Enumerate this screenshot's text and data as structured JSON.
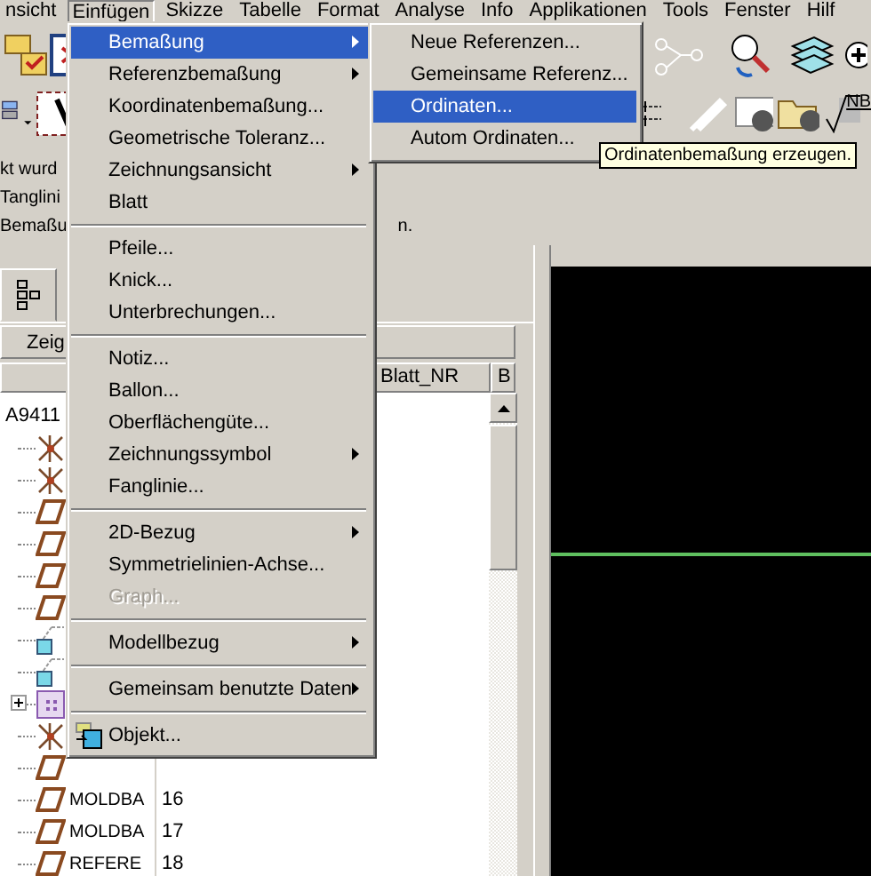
{
  "menubar": [
    {
      "label": "nsicht",
      "selected": false
    },
    {
      "label": "Einfügen",
      "selected": true
    },
    {
      "label": "Skizze",
      "selected": false
    },
    {
      "label": "Tabelle",
      "selected": false
    },
    {
      "label": "Format",
      "selected": false
    },
    {
      "label": "Analyse",
      "selected": false
    },
    {
      "label": "Info",
      "selected": false
    },
    {
      "label": "Applikationen",
      "selected": false
    },
    {
      "label": "Tools",
      "selected": false
    },
    {
      "label": "Fenster",
      "selected": false
    },
    {
      "label": "Hilf",
      "selected": false
    }
  ],
  "toolbar_badge": "NB",
  "message": {
    "lines": [
      "kt wurd",
      "Tanglini",
      "Bemaßu"
    ],
    "tail": "n."
  },
  "panel_bar": "Zeig",
  "tree": {
    "columns": [
      "Blatt_NR",
      "B"
    ],
    "root": "A9411",
    "children": [
      {
        "kind": "datum"
      },
      {
        "kind": "datum"
      },
      {
        "kind": "plane"
      },
      {
        "kind": "plane"
      },
      {
        "kind": "plane"
      },
      {
        "kind": "plane"
      },
      {
        "kind": "csys"
      },
      {
        "kind": "csys"
      },
      {
        "kind": "part",
        "expanded": false
      },
      {
        "kind": "datum"
      },
      {
        "kind": "plane"
      },
      {
        "kind": "plane",
        "name": "MOLDBA",
        "number": "16"
      },
      {
        "kind": "plane",
        "name": "MOLDBA",
        "number": "17"
      },
      {
        "kind": "plane",
        "name": "REFERE",
        "number": "18"
      }
    ]
  },
  "menu": [
    {
      "kind": "item",
      "label": "Bemaßung",
      "submenu": true,
      "selected": true,
      "disabled": false
    },
    {
      "kind": "item",
      "label": "Referenzbemaßung",
      "submenu": true,
      "selected": false,
      "disabled": false
    },
    {
      "kind": "item",
      "label": "Koordinatenbemaßung...",
      "submenu": false,
      "selected": false,
      "disabled": false
    },
    {
      "kind": "item",
      "label": "Geometrische Toleranz...",
      "submenu": false,
      "selected": false,
      "disabled": false
    },
    {
      "kind": "item",
      "label": "Zeichnungsansicht",
      "submenu": true,
      "selected": false,
      "disabled": false
    },
    {
      "kind": "item",
      "label": "Blatt",
      "submenu": false,
      "selected": false,
      "disabled": false
    },
    {
      "kind": "separator"
    },
    {
      "kind": "item",
      "label": "Pfeile...",
      "submenu": false,
      "selected": false,
      "disabled": false
    },
    {
      "kind": "item",
      "label": "Knick...",
      "submenu": false,
      "selected": false,
      "disabled": false
    },
    {
      "kind": "item",
      "label": "Unterbrechungen...",
      "submenu": false,
      "selected": false,
      "disabled": false
    },
    {
      "kind": "separator"
    },
    {
      "kind": "item",
      "label": "Notiz...",
      "submenu": false,
      "selected": false,
      "disabled": false
    },
    {
      "kind": "item",
      "label": "Ballon...",
      "submenu": false,
      "selected": false,
      "disabled": false
    },
    {
      "kind": "item",
      "label": "Oberflächengüte...",
      "submenu": false,
      "selected": false,
      "disabled": false
    },
    {
      "kind": "item",
      "label": "Zeichnungssymbol",
      "submenu": true,
      "selected": false,
      "disabled": false
    },
    {
      "kind": "item",
      "label": "Fanglinie...",
      "submenu": false,
      "selected": false,
      "disabled": false
    },
    {
      "kind": "separator"
    },
    {
      "kind": "item",
      "label": "2D-Bezug",
      "submenu": true,
      "selected": false,
      "disabled": false
    },
    {
      "kind": "item",
      "label": "Symmetrielinien-Achse...",
      "submenu": false,
      "selected": false,
      "disabled": false
    },
    {
      "kind": "item",
      "label": "Graph...",
      "submenu": false,
      "selected": false,
      "disabled": true
    },
    {
      "kind": "separator"
    },
    {
      "kind": "item",
      "label": "Modellbezug",
      "submenu": true,
      "selected": false,
      "disabled": false
    },
    {
      "kind": "separator"
    },
    {
      "kind": "item",
      "label": "Gemeinsam benutzte Daten",
      "submenu": true,
      "selected": false,
      "disabled": false
    },
    {
      "kind": "separator"
    },
    {
      "kind": "icon-item",
      "label": "Objekt...",
      "submenu": false,
      "selected": false,
      "disabled": false
    }
  ],
  "submenu": [
    {
      "label": "Neue Referenzen...",
      "selected": false
    },
    {
      "label": "Gemeinsame Referenz...",
      "selected": false
    },
    {
      "label": "Ordinaten...",
      "selected": true
    },
    {
      "label": "Autom Ordinaten...",
      "selected": false
    }
  ],
  "tooltip": "Ordinatenbemaßung erzeugen."
}
